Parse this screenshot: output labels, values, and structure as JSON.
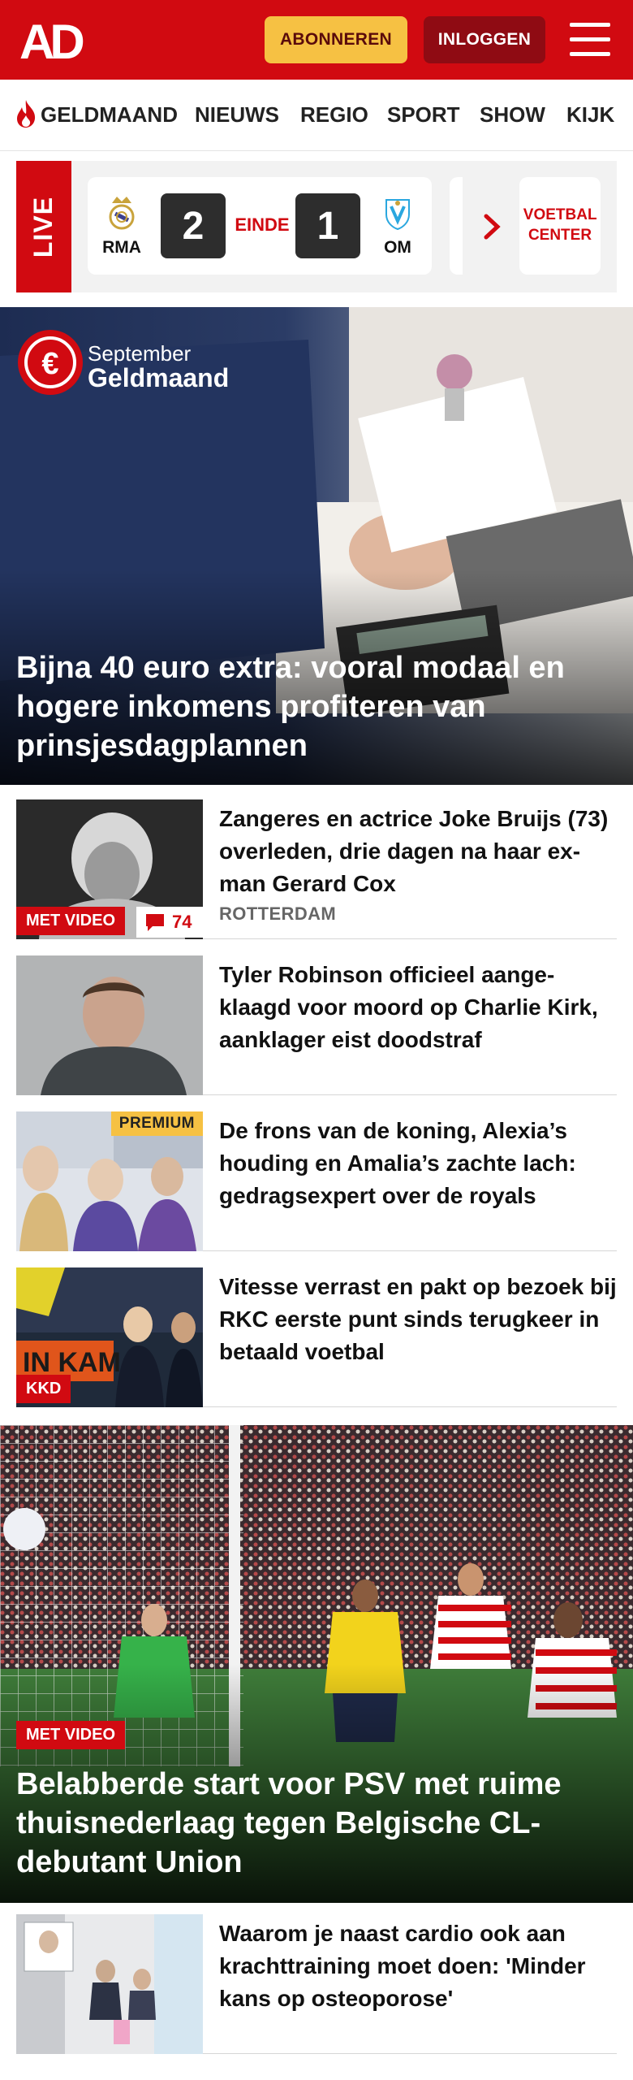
{
  "header": {
    "subscribe_label": "ABONNEREN",
    "login_label": "INLOGGEN",
    "brand_color": "#d10a11",
    "accent_color": "#f6c143",
    "logo_text": "AD"
  },
  "nav": {
    "items": [
      "GELDMAAND",
      "NIEUWS",
      "REGIO",
      "SPORT",
      "SHOW",
      "KIJK"
    ]
  },
  "live": {
    "tab_label": "LIVE",
    "match": {
      "home_team": "RMA",
      "away_team": "OM",
      "home_score": "2",
      "away_score": "1",
      "status": "EINDE"
    },
    "voetbal_center_label": "VOETBAL CENTER"
  },
  "hero": {
    "badge_month": "September",
    "badge_title": "Geldmaand",
    "title": "Bijna 40 euro extra: vooral modaal en hogere inkomens profiteren van prinsjesdagplannen"
  },
  "articles": [
    {
      "title": "Zangeres en actrice Joke Bruijs (73) overleden, drie dagen na haar ex-man Gerard Cox",
      "kicker": "ROTTERDAM",
      "label": "MET VIDEO",
      "comments": "74"
    },
    {
      "title": "Tyler Robinson officieel aange-klaagd voor moord op Charlie Kirk, aanklager eist doodstraf"
    },
    {
      "title": "De frons van de koning, Alexia’s houding en Amalia’s zachte lach: gedragsexpert over de royals",
      "label": "PREMIUM"
    },
    {
      "title": "Vitesse verrast en pakt op bezoek bij RKC eerste punt sinds terugkeer in betaald voetbal",
      "label": "KKD"
    }
  ],
  "video_story": {
    "label": "MET VIDEO",
    "title": "Belabberde start voor PSV met ruime thuisnederlaag tegen Belgische CL-debutant Union"
  },
  "article_bottom": {
    "title": "Waarom je naast cardio ook aan krachttraining moet doen: 'Minder kans op osteoporose'"
  }
}
